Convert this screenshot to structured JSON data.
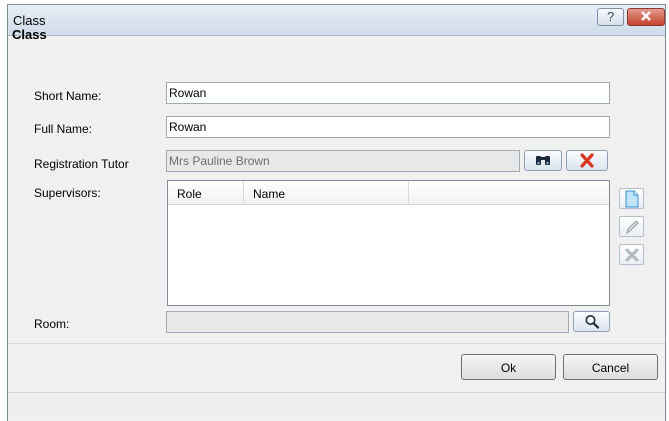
{
  "window": {
    "title": "Class",
    "help_icon": "help-icon",
    "close_icon": "close-icon"
  },
  "section_title": "Class",
  "form": {
    "short_name": {
      "label": "Short Name:",
      "value": "Rowan"
    },
    "full_name": {
      "label": "Full Name:",
      "value": "Rowan"
    },
    "registration_tutor": {
      "label": "Registration Tutor",
      "value": "Mrs Pauline Brown"
    },
    "supervisors": {
      "label": "Supervisors:",
      "columns": [
        "Role",
        "Name"
      ],
      "rows": []
    },
    "room": {
      "label": "Room:",
      "value": ""
    }
  },
  "buttons": {
    "ok": "Ok",
    "cancel": "Cancel"
  },
  "icons": {
    "find": "binoculars-icon",
    "clear": "red-x-icon",
    "new": "new-document-icon",
    "edit": "pencil-icon",
    "delete": "delete-x-icon",
    "room_search": "magnifier-icon"
  }
}
